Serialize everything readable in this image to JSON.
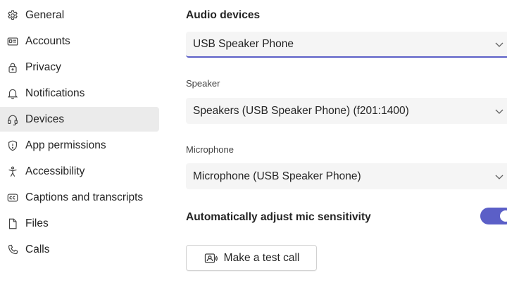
{
  "sidebar": {
    "items": [
      {
        "label": "General",
        "icon": "gear-icon",
        "active": false
      },
      {
        "label": "Accounts",
        "icon": "id-card-icon",
        "active": false
      },
      {
        "label": "Privacy",
        "icon": "lock-icon",
        "active": false
      },
      {
        "label": "Notifications",
        "icon": "bell-icon",
        "active": false
      },
      {
        "label": "Devices",
        "icon": "headset-icon",
        "active": true
      },
      {
        "label": "App permissions",
        "icon": "shield-icon",
        "active": false
      },
      {
        "label": "Accessibility",
        "icon": "accessibility-icon",
        "active": false
      },
      {
        "label": "Captions and transcripts",
        "icon": "cc-icon",
        "active": false
      },
      {
        "label": "Files",
        "icon": "file-icon",
        "active": false
      },
      {
        "label": "Calls",
        "icon": "phone-icon",
        "active": false
      }
    ]
  },
  "main": {
    "section_title": "Audio devices",
    "audio_device": {
      "value": "USB Speaker Phone"
    },
    "speaker": {
      "label": "Speaker",
      "value": "Speakers (USB Speaker Phone) (f201:1400)"
    },
    "microphone": {
      "label": "Microphone",
      "value": "Microphone (USB Speaker Phone)"
    },
    "mic_sensitivity": {
      "label": "Automatically adjust mic sensitivity",
      "enabled": true
    },
    "test_call_button": {
      "label": "Make a test call",
      "icon": "call-test-icon"
    }
  },
  "colors": {
    "accent": "#5b5fc7",
    "active_nav_bg": "#ebebeb",
    "dropdown_bg": "#f5f5f5"
  }
}
